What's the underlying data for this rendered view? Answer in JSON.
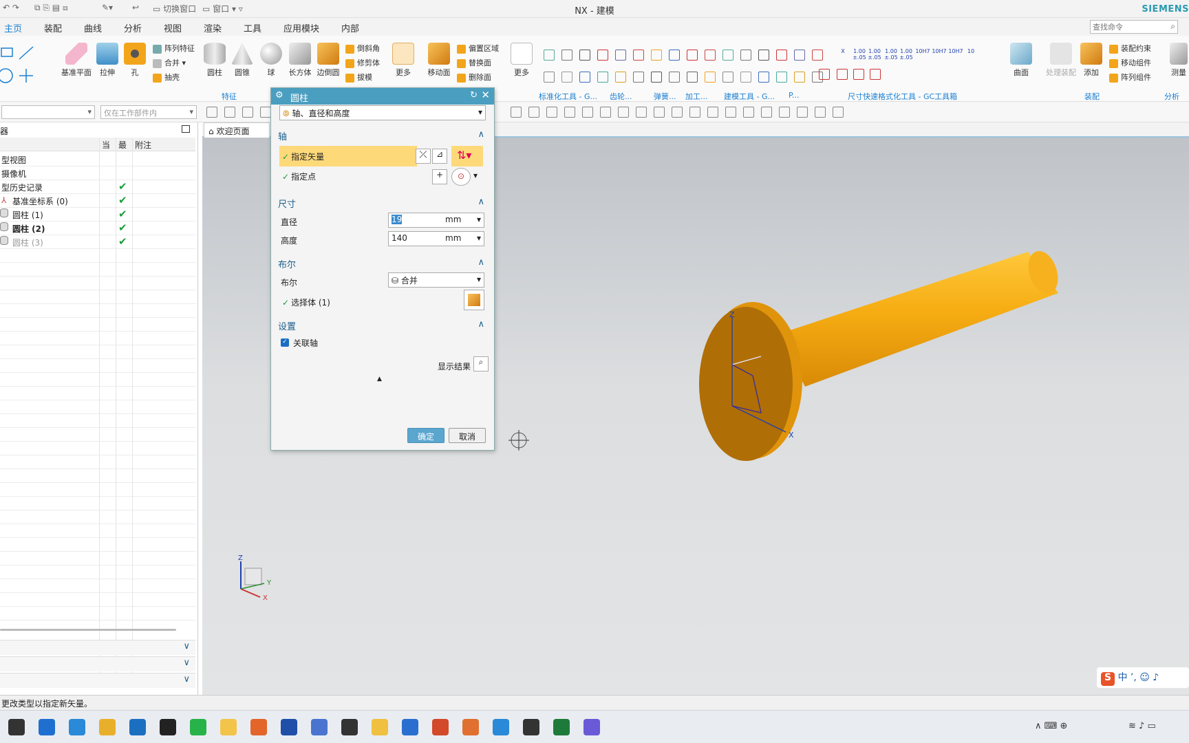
{
  "window": {
    "title": "NX - 建模",
    "brand": "SIEMENS"
  },
  "quick_access": {
    "switch_window": "切换窗口",
    "window_menu": "窗口"
  },
  "search": {
    "placeholder": "查找命令"
  },
  "tabs": [
    {
      "label": "主页",
      "active": true
    },
    {
      "label": "装配"
    },
    {
      "label": "曲线"
    },
    {
      "label": "分析"
    },
    {
      "label": "视图"
    },
    {
      "label": "渲染"
    },
    {
      "label": "工具"
    },
    {
      "label": "应用模块"
    },
    {
      "label": "内部"
    }
  ],
  "ribbon": {
    "datum_plane": "基准平面",
    "extrude": "拉伸",
    "hole": "孔",
    "pattern_feature": "阵列特征",
    "unite": "合并",
    "shell": "抽壳",
    "cylinder": "圆柱",
    "cone": "圆锥",
    "sphere": "球",
    "block": "长方体",
    "edge_blend": "边倒圆",
    "chamfer": "倒斜角",
    "trim_body": "修剪体",
    "draft": "拔模",
    "more": "更多",
    "move_face": "移动面",
    "offset_region": "偏置区域",
    "replace_face": "替换面",
    "delete_face": "删除面",
    "more2": "更多",
    "surface": "曲面",
    "process_assembly": "处理装配",
    "add": "添加",
    "assembly_constraint": "装配约束",
    "move_component": "移动组件",
    "pattern_component": "阵列组件",
    "measure": "测量",
    "groups": {
      "feature": "特征",
      "std_tools": "标准化工具 - G...",
      "gear": "齿轮...",
      "spring": "弹簧...",
      "machining": "加工...",
      "modeling_tools": "建模工具 - G...",
      "p": "P...",
      "dim_tools": "尺寸快速格式化工具 - GC工具箱",
      "assembly": "装配",
      "analysis": "分析"
    },
    "dim_labels": [
      "X",
      "1.00\n±.05",
      "1.00\n±.05",
      "1.00\n±.05",
      "1.00\n±.05",
      "10H7",
      "10H7",
      "10H7",
      "10"
    ]
  },
  "filter": {
    "scope": "仅在工作部件内"
  },
  "navigator": {
    "title": "器",
    "columns": {
      "name": "",
      "current": "当",
      "latest": "最",
      "notes": "附注"
    },
    "rows": [
      {
        "label": "型视图",
        "check": false,
        "bold": false,
        "gray": false
      },
      {
        "label": "摄像机",
        "check": false,
        "bold": false,
        "gray": false
      },
      {
        "label": "型历史记录",
        "check": true,
        "bold": false,
        "gray": false
      },
      {
        "label": "基准坐标系 (0)",
        "check": true,
        "bold": false,
        "gray": false
      },
      {
        "label": "圆柱 (1)",
        "check": true,
        "bold": false,
        "gray": false
      },
      {
        "label": "圆柱 (2)",
        "check": true,
        "bold": true,
        "gray": false
      },
      {
        "label": "圆柱 (3)",
        "check": true,
        "bold": false,
        "gray": true
      }
    ],
    "check_mark": "✔"
  },
  "welcome_tab": "欢迎页面",
  "dialog": {
    "title": "圆柱",
    "type_value": "轴、直径和高度",
    "sections": {
      "axis": "轴",
      "dimensions": "尺寸",
      "boolean": "布尔",
      "settings": "设置"
    },
    "specify_vector": "指定矢量",
    "specify_point": "指定点",
    "diameter_label": "直径",
    "diameter_value": "19",
    "diameter_unit": "mm",
    "height_label": "高度",
    "height_value": "140",
    "height_unit": "mm",
    "boolean_label": "布尔",
    "boolean_value": "合并",
    "select_body": "选择体 (1)",
    "associative_axis": "关联轴",
    "show_result": "显示结果",
    "ok": "确定",
    "cancel": "取消"
  },
  "triad": {
    "z": "Z",
    "x": "X",
    "y": "Y"
  },
  "status": "更改类型以指定新矢量。",
  "ime": {
    "lang": "中"
  },
  "colors": {
    "accent": "#1b7fd1",
    "dialog_title": "#4a9ec0",
    "part": "#f1a614",
    "highlight": "#fdd97a"
  }
}
